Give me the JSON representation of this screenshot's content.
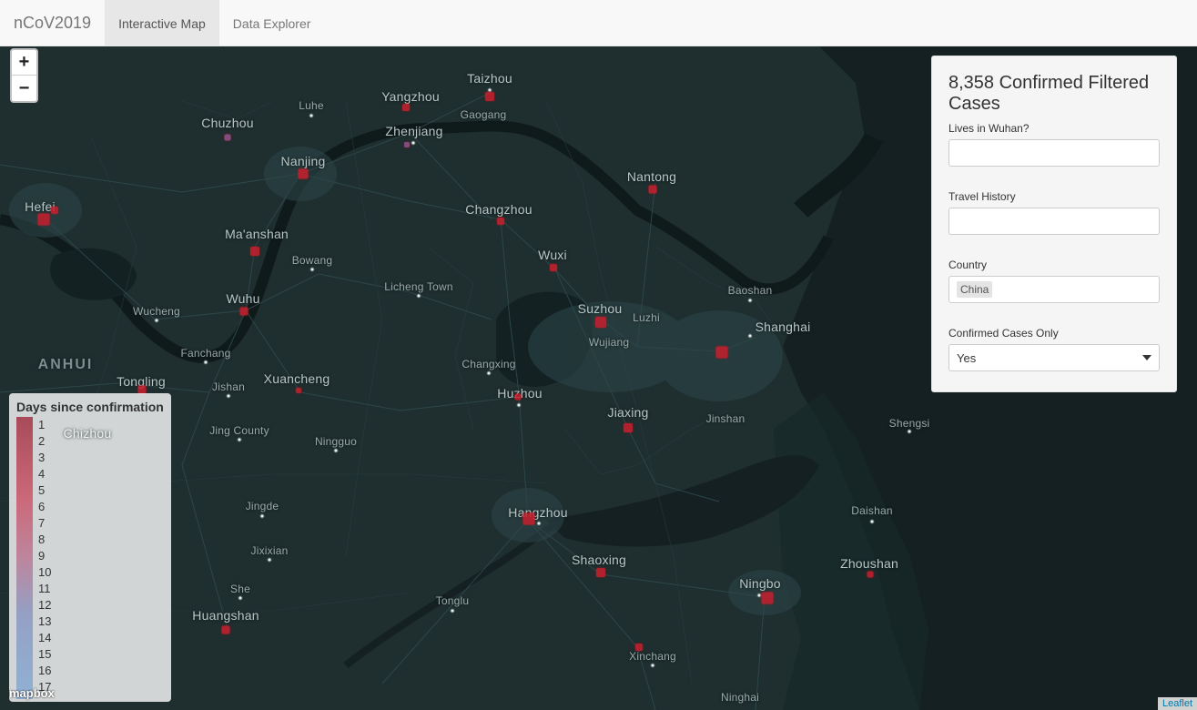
{
  "navbar": {
    "brand": "nCoV2019",
    "tabs": [
      {
        "label": "Interactive Map",
        "active": true
      },
      {
        "label": "Data Explorer",
        "active": false
      }
    ]
  },
  "zoom": {
    "in": "+",
    "out": "−"
  },
  "panel": {
    "title": "8,358 Confirmed Filtered Cases",
    "fields": [
      {
        "label": "Lives in Wuhan?",
        "value": ""
      },
      {
        "label": "Travel History",
        "value": ""
      },
      {
        "label": "Country",
        "value": "China"
      },
      {
        "label": "Confirmed Cases Only",
        "value": "Yes"
      }
    ]
  },
  "legend": {
    "title": "Days since confirmation",
    "labels": [
      "1",
      "2",
      "3",
      "4",
      "5",
      "6",
      "7",
      "8",
      "9",
      "10",
      "11",
      "12",
      "13",
      "14",
      "15",
      "16",
      "17"
    ]
  },
  "map": {
    "province": "ANHUI",
    "cities": {
      "taizhou": "Taizhou",
      "yangzhou": "Yangzhou",
      "luhe": "Luhe",
      "chuzhou": "Chuzhou",
      "zhenjiang": "Zhenjiang",
      "gaogang": "Gaogang",
      "nanjing": "Nanjing",
      "nantong": "Nantong",
      "hefei": "Hefei",
      "changzhou": "Changzhou",
      "maanshan": "Ma'anshan",
      "wuxi": "Wuxi",
      "bowang": "Bowang",
      "licheng": "Licheng Town",
      "baoshan": "Baoshan",
      "wuhu": "Wuhu",
      "suzhou": "Suzhou",
      "wucheng": "Wucheng",
      "luzhi": "Luzhi",
      "shanghai": "Shanghai",
      "wujiang": "Wujiang",
      "fanchang": "Fanchang",
      "changxing": "Changxing",
      "tongling": "Tongling",
      "xuancheng": "Xuancheng",
      "jishan": "Jishan",
      "huzhou": "Huzhou",
      "jiaxing": "Jiaxing",
      "jinshan": "Jinshan",
      "shengsi": "Shengsi",
      "chizhou": "Chizhou",
      "jingcounty": "Jing County",
      "ningguo": "Ningguo",
      "jingde": "Jingde",
      "hangzhou": "Hangzhou",
      "daishan": "Daishan",
      "jixixian": "Jixixian",
      "shaoxing": "Shaoxing",
      "zhoushan": "Zhoushan",
      "she": "She",
      "ningbo": "Ningbo",
      "tonglu": "Tonglu",
      "huangshan": "Huangshan",
      "xinchang": "Xinchang",
      "ninghai": "Ninghai"
    }
  },
  "mapbox_logo": "mapbox",
  "attribution": "Leaflet"
}
